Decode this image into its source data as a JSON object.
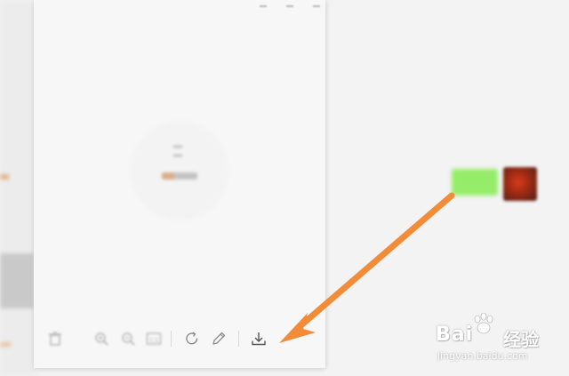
{
  "toolbar": {
    "buttons": [
      {
        "icon": "trash-icon"
      },
      {
        "icon": "zoom-in-icon"
      },
      {
        "icon": "zoom-out-icon"
      },
      {
        "icon": "actual-size-icon",
        "label": "1:1"
      },
      {
        "icon": "rotate-icon"
      },
      {
        "icon": "edit-icon"
      },
      {
        "icon": "download-icon"
      }
    ]
  },
  "overlay": {
    "arrow_color": "#f28c38"
  },
  "watermark": {
    "brand": "Bai",
    "brand_suffix": "经验",
    "url": "jingyan.baidu.com"
  },
  "colors": {
    "chat_bubble": "#95ec69",
    "viewer_background": "#f7f7f7"
  }
}
